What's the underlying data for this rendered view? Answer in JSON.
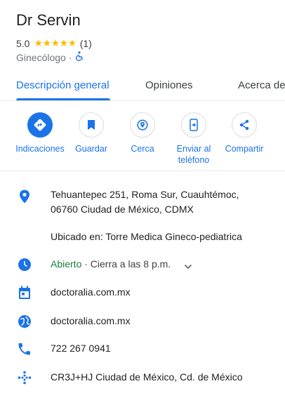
{
  "place": {
    "name": "Dr Servin",
    "rating": "5.0",
    "stars": "★★★★★",
    "review_count": "(1)",
    "category": "Ginecólogo",
    "separator": "·"
  },
  "tabs": [
    {
      "label": "Descripción general",
      "active": true
    },
    {
      "label": "Opiniones",
      "active": false
    },
    {
      "label": "Acerca de",
      "active": false
    }
  ],
  "actions": [
    {
      "label": "Indicaciones",
      "icon": "directions-icon"
    },
    {
      "label": "Guardar",
      "icon": "bookmark-icon"
    },
    {
      "label": "Cerca",
      "icon": "nearby-icon"
    },
    {
      "label": "Enviar al teléfono",
      "icon": "send-to-phone-icon"
    },
    {
      "label": "Compartir",
      "icon": "share-icon"
    }
  ],
  "info": {
    "address_line1": "Tehuantepec 251, Roma Sur, Cuauhtémoc,",
    "address_line2": "06760 Ciudad de México, CDMX",
    "located_in": "Ubicado en: Torre Medica Gineco-pediatrica",
    "hours_status": "Abierto",
    "hours_detail": " · Cierra a las 8 p.m.",
    "booking": "doctoralia.com.mx",
    "website": "doctoralia.com.mx",
    "phone": "722 267 0941",
    "plus_code": "CR3J+HJ Ciudad de México, Cd. de México"
  },
  "colors": {
    "accent": "#1a73e8",
    "open": "#188038",
    "star": "#fbbc04"
  }
}
